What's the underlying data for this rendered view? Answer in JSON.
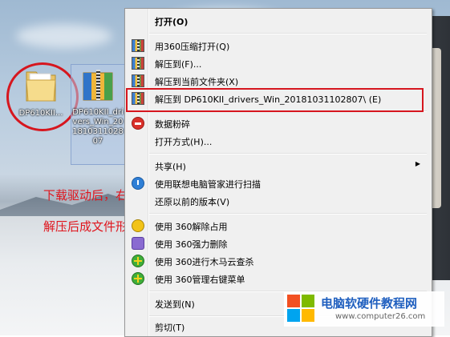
{
  "desktop": {
    "folder_icon_label": "DP610KII...",
    "archive_icon_label": "DP610KII_drivers_Win_20181031102807"
  },
  "annotations": {
    "line1": "下载驱动后，右键解压",
    "line2": "解压后成文件形式，如图"
  },
  "context_menu": {
    "open": "打开(O)",
    "open_360": "用360压缩打开(Q)",
    "extract_to": "解压到(F)...",
    "extract_here": "解压到当前文件夹(X)",
    "extract_to_folder": "解压到 DP610KII_drivers_Win_20181031102807\\ (E)",
    "shred": "数据粉碎",
    "open_with": "打开方式(H)...",
    "share": "共享(H)",
    "lenovo_scan": "使用联想电脑管家进行扫描",
    "restore_prev": "还原以前的版本(V)",
    "unlock_360": "使用 360解除占用",
    "force_delete_360": "使用 360强力删除",
    "trojan_scan_360": "使用 360进行木马云查杀",
    "manage_menu_360": "使用 360管理右键菜单",
    "send_to": "发送到(N)",
    "cut": "剪切(T)"
  },
  "watermark": {
    "title": "电脑软硬件教程网",
    "url": "www.computer26.com"
  },
  "colors": {
    "annotation_red": "#e0141c",
    "menu_bg": "#f0f0f0",
    "watermark_blue": "#1f5fbf"
  }
}
